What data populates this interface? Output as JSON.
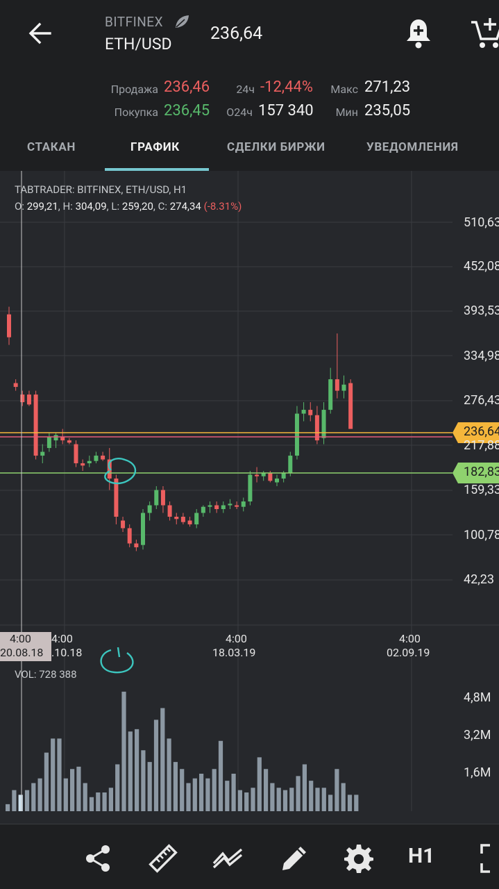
{
  "header": {
    "exchange": "BITFINEX",
    "pair": "ETH/USD",
    "price": "236,64",
    "stats": {
      "sell_label": "Продажа",
      "sell_value": "236,46",
      "buy_label": "Покупка",
      "buy_value": "236,45",
      "change_label": "24ч",
      "change_value": "-12,44%",
      "volume_label": "О24ч",
      "volume_value": "157 340",
      "max_label": "Макс",
      "max_value": "271,23",
      "min_label": "Мин",
      "min_value": "235,05"
    }
  },
  "tabs": [
    {
      "label": "СТАКАН"
    },
    {
      "label": "ГРАФИК"
    },
    {
      "label": "СДЕЛКИ БИРЖИ"
    },
    {
      "label": "УВЕДОМЛЕНИЯ"
    }
  ],
  "chart": {
    "title": "TABTRADER: BITFINEX, ETH/USD, H1",
    "ohlc": {
      "o_label": "O:",
      "o": "299,21",
      "h_label": "H:",
      "h": "304,09",
      "l_label": "L:",
      "l": "259,20",
      "c_label": "C:",
      "c": "274,34",
      "chg": "(-8.31%)"
    },
    "vol_label": "VOL: 728 388",
    "price_labels": [
      "510,63",
      "452,08",
      "393,53",
      "334,98",
      "276,43",
      "217,88",
      "159,33",
      "100,78",
      "42,23"
    ],
    "current_price_tag": "236,64",
    "alert_price_tag": "182,83",
    "time_labels": [
      {
        "time": "4:00",
        "date": ".10.18"
      },
      {
        "time": "4:00",
        "date": "18.03.19"
      },
      {
        "time": "4:00",
        "date": "02.09.19"
      }
    ],
    "crosshair_label": {
      "time": "4:00",
      "date": "20.08.18"
    },
    "vol_axis_labels": [
      "4,8M",
      "3,2M",
      "1,6M"
    ],
    "colors": {
      "up": "#58b96b",
      "down": "#ec5f5f",
      "volume": "#8c98a3",
      "current": "#f5b63b",
      "alert": "#8fd26e"
    }
  },
  "toolbar": {
    "icons": [
      "share-icon",
      "ruler-icon",
      "indicators-icon",
      "pencil-icon",
      "gear-icon",
      "fullscreen-icon"
    ],
    "timeframe": "H1"
  },
  "chart_data": {
    "type": "candlestick",
    "xlabels": [
      "20.08.18",
      ".10.18",
      "18.03.19",
      "02.09.19"
    ],
    "ylim": [
      42.23,
      510.63
    ],
    "candles": [
      [
        390,
        400,
        350,
        360
      ],
      [
        300,
        305,
        290,
        295
      ],
      [
        285,
        290,
        270,
        275
      ],
      [
        285,
        290,
        270,
        272
      ],
      [
        285,
        290,
        200,
        205
      ],
      [
        205,
        220,
        195,
        210
      ],
      [
        215,
        235,
        210,
        230
      ],
      [
        225,
        235,
        215,
        232
      ],
      [
        230,
        240,
        220,
        225
      ],
      [
        225,
        228,
        220,
        222
      ],
      [
        220,
        225,
        190,
        195
      ],
      [
        195,
        200,
        185,
        192
      ],
      [
        195,
        205,
        190,
        198
      ],
      [
        198,
        210,
        195,
        205
      ],
      [
        205,
        210,
        198,
        200
      ],
      [
        200,
        215,
        160,
        175
      ],
      [
        175,
        180,
        115,
        125
      ],
      [
        120,
        125,
        105,
        110
      ],
      [
        110,
        115,
        85,
        90
      ],
      [
        90,
        95,
        80,
        85
      ],
      [
        88,
        135,
        82,
        130
      ],
      [
        130,
        145,
        120,
        140
      ],
      [
        140,
        165,
        135,
        160
      ],
      [
        160,
        165,
        130,
        140
      ],
      [
        140,
        145,
        120,
        125
      ],
      [
        125,
        130,
        115,
        122
      ],
      [
        125,
        130,
        115,
        118
      ],
      [
        120,
        125,
        112,
        115
      ],
      [
        115,
        135,
        110,
        130
      ],
      [
        130,
        140,
        125,
        138
      ],
      [
        138,
        145,
        130,
        140
      ],
      [
        140,
        145,
        130,
        135
      ],
      [
        135,
        145,
        130,
        140
      ],
      [
        140,
        148,
        135,
        142
      ],
      [
        140,
        145,
        135,
        138
      ],
      [
        138,
        150,
        132,
        145
      ],
      [
        145,
        185,
        140,
        180
      ],
      [
        180,
        190,
        170,
        178
      ],
      [
        178,
        185,
        172,
        182
      ],
      [
        182,
        185,
        170,
        172
      ],
      [
        170,
        180,
        165,
        175
      ],
      [
        175,
        185,
        170,
        182
      ],
      [
        182,
        210,
        178,
        205
      ],
      [
        205,
        270,
        200,
        260
      ],
      [
        260,
        275,
        250,
        265
      ],
      [
        265,
        275,
        250,
        258
      ],
      [
        258,
        270,
        220,
        225
      ],
      [
        228,
        275,
        220,
        265
      ],
      [
        265,
        320,
        260,
        305
      ],
      [
        305,
        365,
        280,
        290
      ],
      [
        290,
        310,
        280,
        298
      ],
      [
        300,
        305,
        240,
        240
      ]
    ],
    "volumes": [
      0.3,
      0.9,
      0.7,
      0.9,
      1.2,
      1.4,
      2.5,
      3.1,
      3.1,
      1.4,
      1.8,
      1.9,
      1.2,
      0.6,
      0.8,
      0.8,
      1.0,
      2.0,
      5.1,
      3.4,
      3.5,
      2.6,
      2.1,
      3.9,
      4.4,
      3.1,
      2.1,
      1.8,
      1.2,
      1.4,
      1.6,
      1.4,
      1.8,
      3.0,
      1.3,
      1.6,
      0.9,
      0.8,
      1.0,
      2.3,
      1.8,
      1.2,
      1.0,
      0.9,
      1.0,
      1.5,
      2.0,
      1.3,
      1.0,
      1.0,
      0.7,
      1.8,
      1.2,
      0.7,
      0.7
    ]
  }
}
